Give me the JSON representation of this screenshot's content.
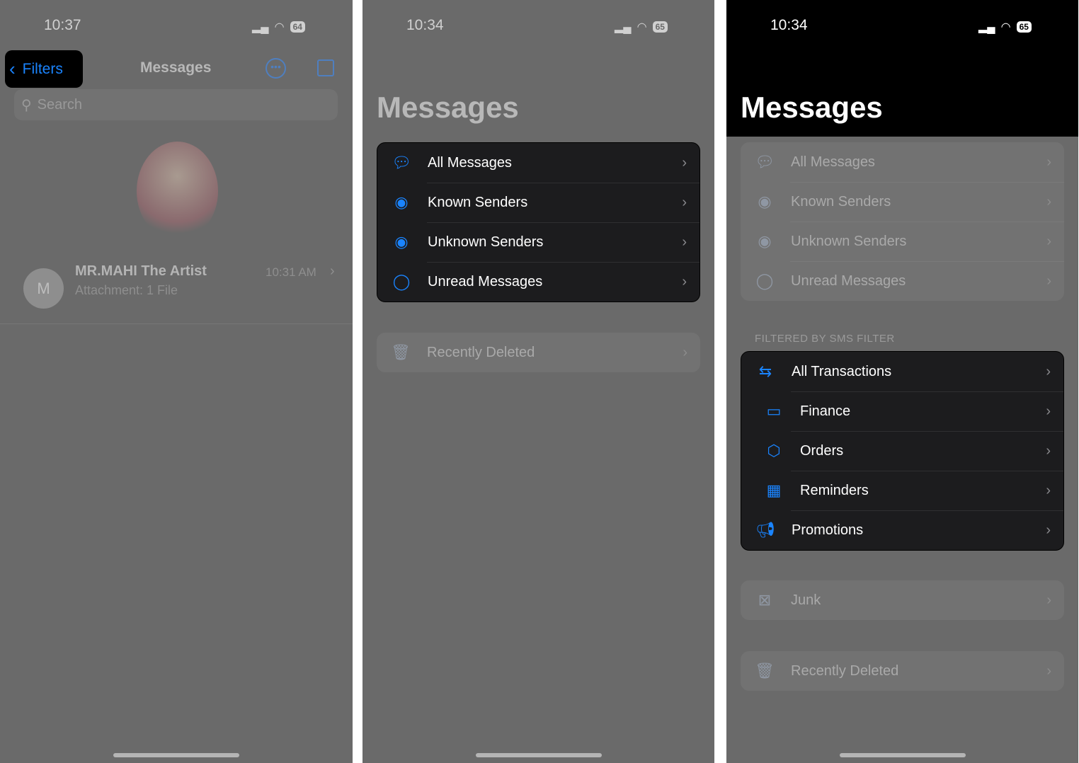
{
  "panel1": {
    "time": "10:37",
    "battery": "64",
    "back_label": "Filters",
    "title": "Messages",
    "search_placeholder": "Search",
    "conversation": {
      "avatar_initial": "M",
      "name": "MR.MAHI The Artist",
      "time": "10:31 AM",
      "preview": "Attachment: 1 File"
    }
  },
  "panel2": {
    "time": "10:34",
    "battery": "65",
    "title": "Messages",
    "filters": [
      {
        "label": "All Messages",
        "icon": "speech-bubbles-icon"
      },
      {
        "label": "Known Senders",
        "icon": "person-circle-icon"
      },
      {
        "label": "Unknown Senders",
        "icon": "person-question-icon"
      },
      {
        "label": "Unread Messages",
        "icon": "bubble-badge-icon"
      }
    ],
    "recently_deleted": "Recently Deleted"
  },
  "panel3": {
    "time": "10:34",
    "battery": "65",
    "title": "Messages",
    "filters": [
      {
        "label": "All Messages"
      },
      {
        "label": "Known Senders"
      },
      {
        "label": "Unknown Senders"
      },
      {
        "label": "Unread Messages"
      }
    ],
    "section_header": "FILTERED BY SMS FILTER",
    "sms_filters": [
      {
        "label": "All Transactions",
        "icon": "arrows-swap-icon"
      },
      {
        "label": "Finance",
        "icon": "credit-card-icon"
      },
      {
        "label": "Orders",
        "icon": "box-icon"
      },
      {
        "label": "Reminders",
        "icon": "calendar-clock-icon"
      },
      {
        "label": "Promotions",
        "icon": "megaphone-icon"
      }
    ],
    "junk": "Junk",
    "recently_deleted": "Recently Deleted"
  },
  "colors": {
    "accent": "#1a84ff",
    "background_dimmed": "#6a6a6a",
    "list_dark": "#1c1c1e"
  }
}
